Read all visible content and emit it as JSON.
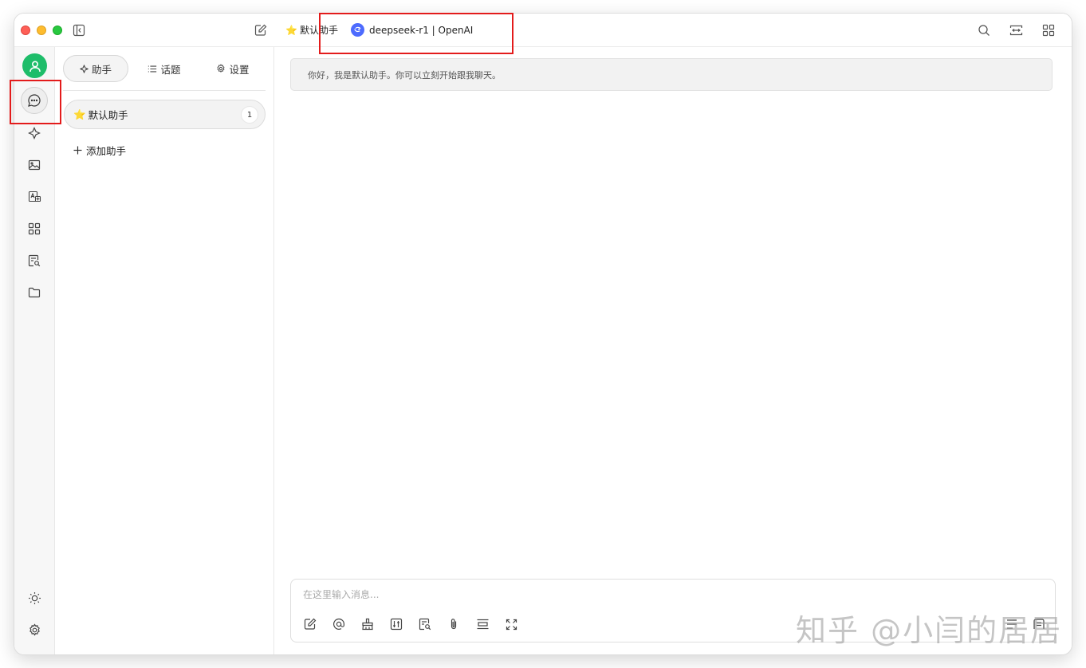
{
  "titlebar": {
    "assistant_emoji": "⭐️",
    "assistant_name": "默认助手",
    "model_label": "deepseek-r1 | OpenAI"
  },
  "sidebar": {
    "tabs": [
      {
        "label": "助手",
        "icon": "sparkle-icon",
        "active": true
      },
      {
        "label": "话题",
        "icon": "list-icon"
      },
      {
        "label": "设置",
        "icon": "gear-icon"
      }
    ],
    "assistants": [
      {
        "emoji": "⭐️",
        "name": "默认助手",
        "count": "1"
      }
    ],
    "add_label": "添加助手"
  },
  "main": {
    "welcome_message": "你好，我是默认助手。你可以立刻开始跟我聊天。",
    "input_placeholder": "在这里输入消息..."
  },
  "watermark": "知乎 @小闫的居居",
  "colors": {
    "avatar": "#1ebd6a",
    "highlight": "#e31b1b",
    "model_logo": "#4d6bfe"
  }
}
